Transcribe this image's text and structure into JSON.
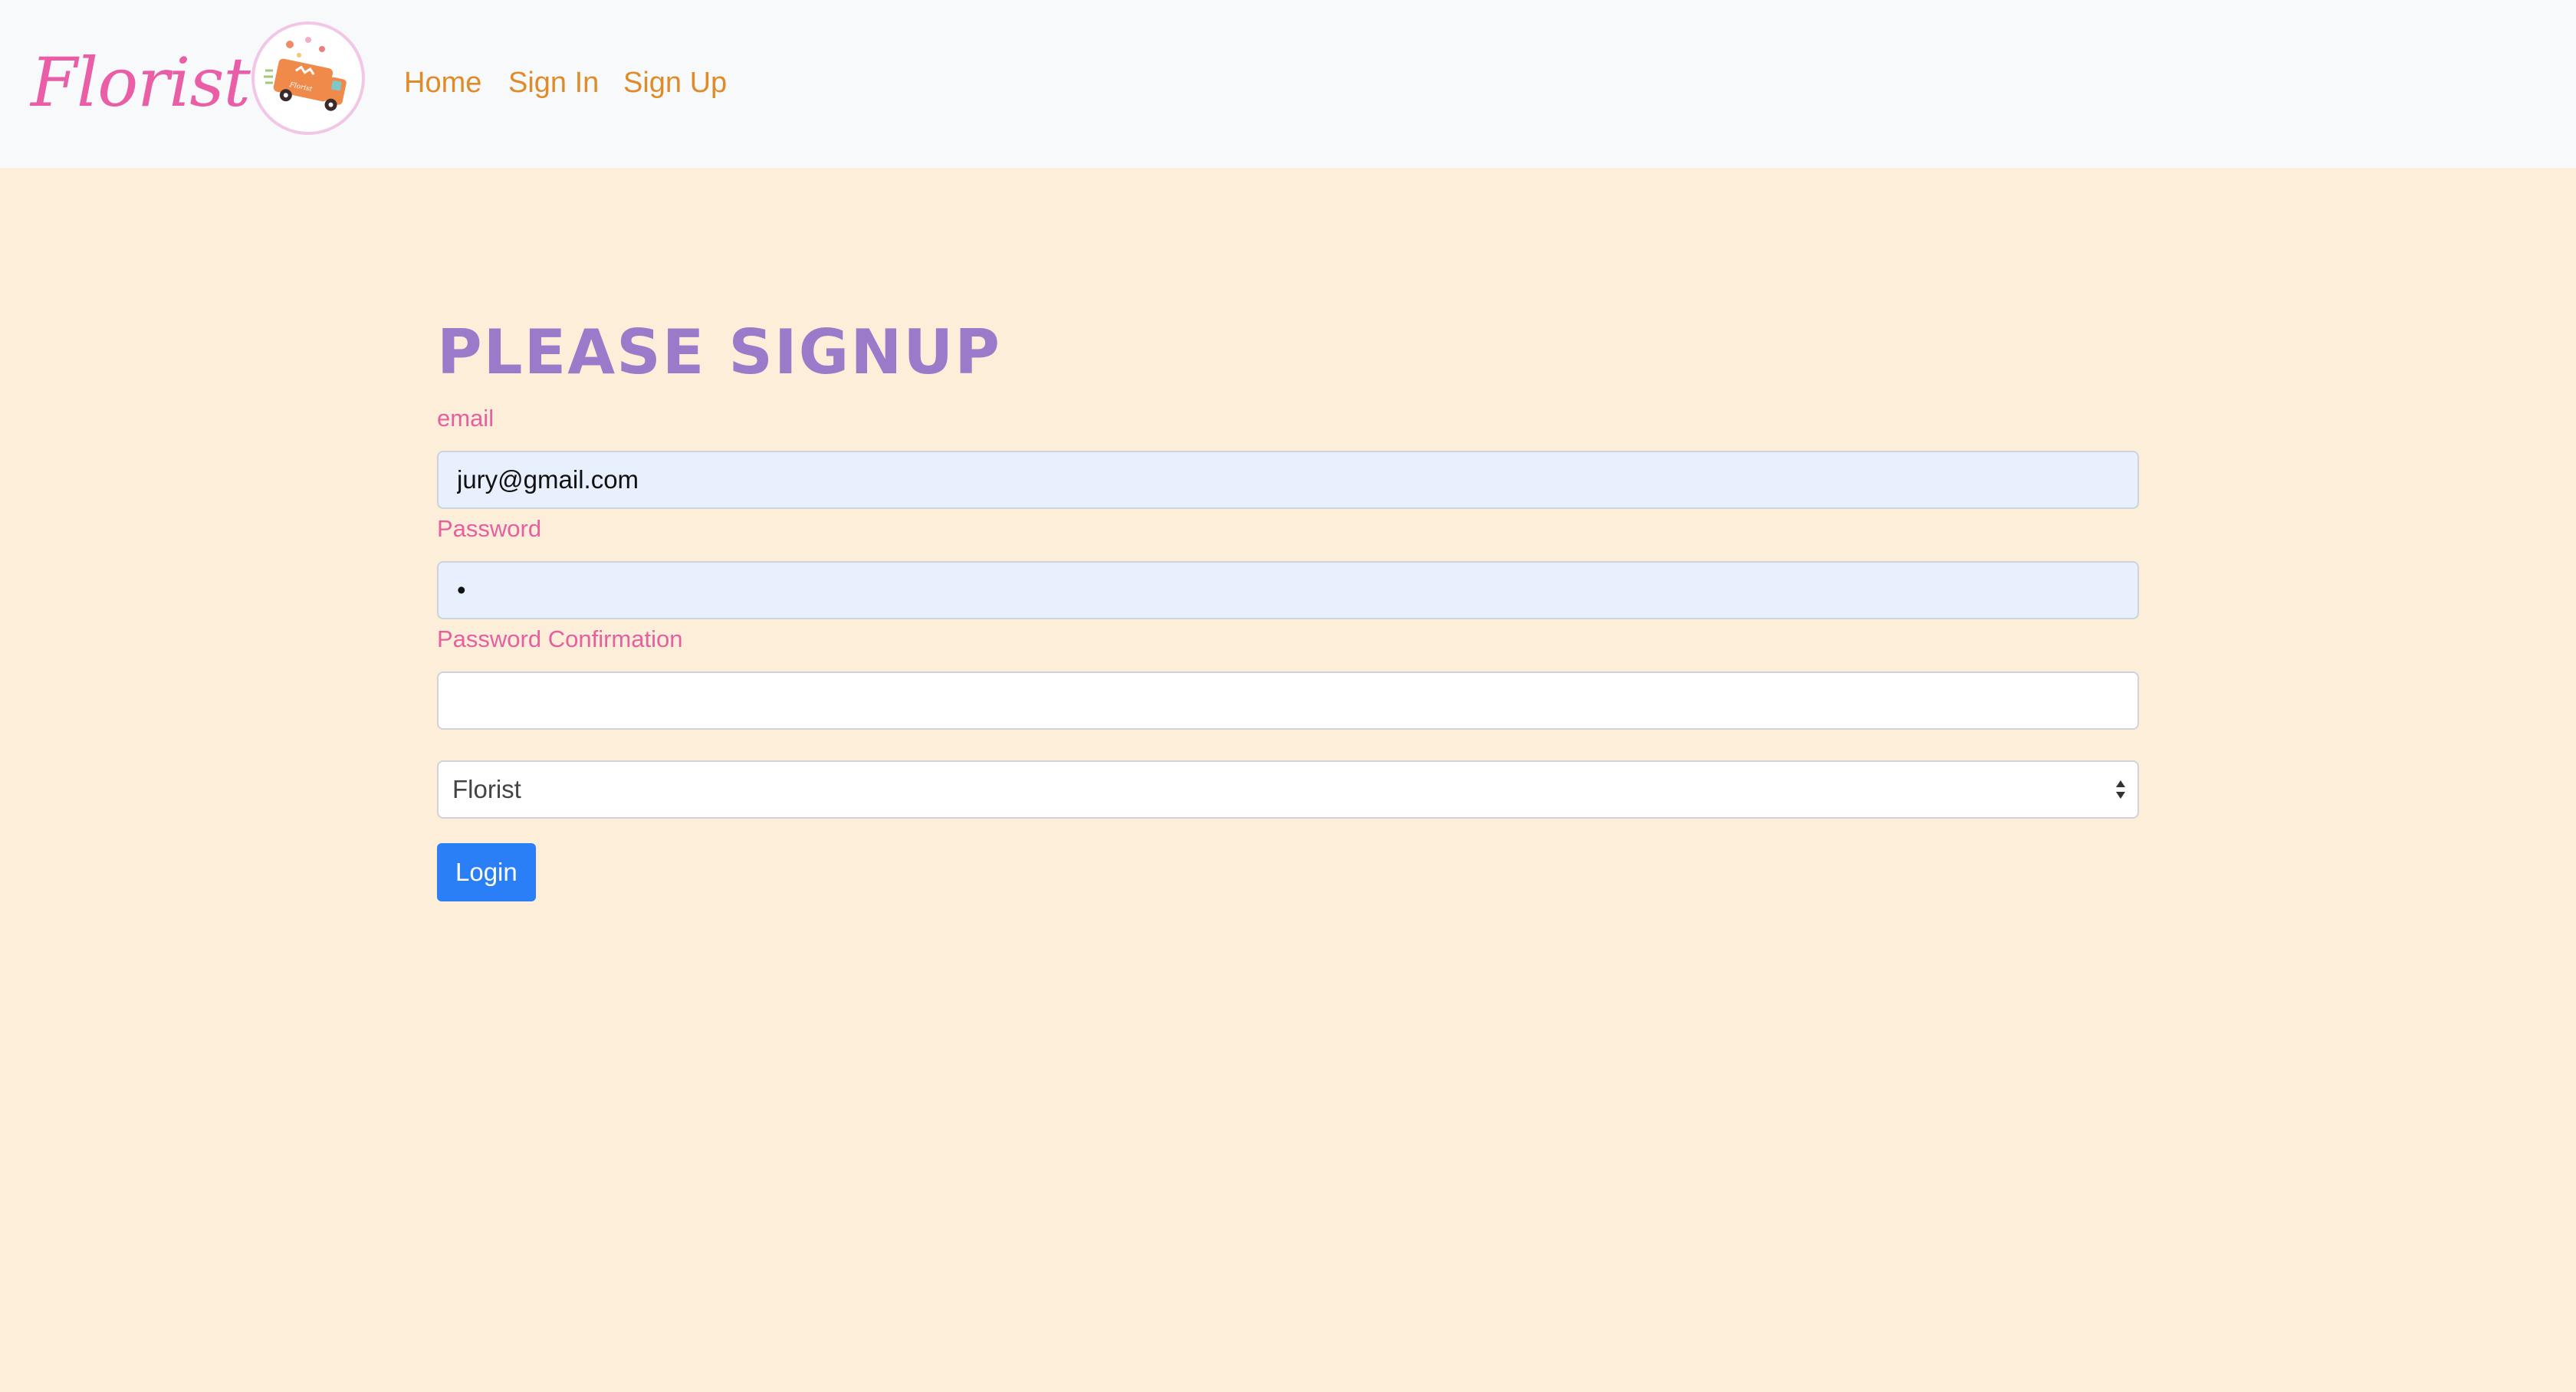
{
  "navbar": {
    "brand": "Florist",
    "links": [
      {
        "label": "Home"
      },
      {
        "label": "Sign In"
      },
      {
        "label": "Sign Up"
      }
    ],
    "logo_icon": "delivery-van-icon"
  },
  "form": {
    "title": "PLEASE SIGNUP",
    "email_label": "email",
    "email_value": "jury@gmail.com",
    "password_label": "Password",
    "password_value": "•",
    "password_confirmation_label": "Password Confirmation",
    "password_confirmation_value": "",
    "role_select": {
      "selected": "Florist"
    },
    "submit_label": "Login"
  },
  "colors": {
    "page_background": "#FDEEDA",
    "navbar_background": "#F8F9FB",
    "brand": "#E95EA6",
    "nav_link": "#DF8B2A",
    "title": "#9B7AC9",
    "label": "#E6609F",
    "autofill": "#E8F0FE",
    "button": "#2B7FF6"
  }
}
